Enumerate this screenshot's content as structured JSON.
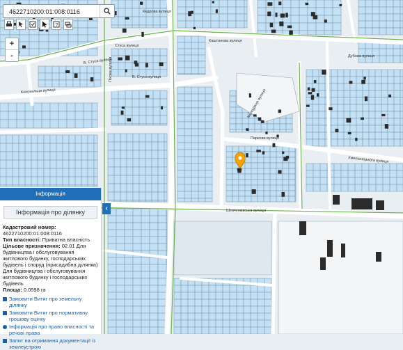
{
  "search": {
    "value": "4622710200:01:008:0116"
  },
  "toolbar": {
    "icons": [
      "print-icon",
      "cursor-icon",
      "edit-icon",
      "pointer-icon",
      "info-icon",
      "layers-icon"
    ]
  },
  "zoom": {
    "plus": "+",
    "minus": "-"
  },
  "streets": {
    "top": "Кедрова вулиця",
    "stus1": "Стуса вулиця",
    "stus2": "В. Стуса вулиця",
    "stus3": "В. Стуса вулиця",
    "konovaltsia": "Коновальця вулиця",
    "pikhova": "Піхова вулиця",
    "right_top": "Каштанова вулиця",
    "dubova": "Дубова вулиця",
    "parkova": "Паркова вулиця",
    "khmelnytskoho": "Хмельницького вулиця",
    "vertical": "Молодіжна вулиця",
    "bottom": "Шевченківська вулиця"
  },
  "panel": {
    "header": "Інформація",
    "title": "Інформація про ділянку",
    "cad_label": "Кадастровий номер:",
    "cad_value": "4622710200:01:008:0116",
    "own_label": "Тип власності:",
    "own_value": "Приватна власність",
    "purpose_label": "Цільове призначення:",
    "purpose_value": "02.01 Для будівництва і обслуговування житлового будинку, господарських будівель і споруд (присадибна ділянка) Для будівництва і обслуговування житлового будинку і господарських будівель",
    "area_label": "Площа:",
    "area_value": "0.0598 га",
    "links": [
      "Замовити Витяг про земельну ділянку",
      "Замовити Витяг про нормативну грошову оцінку",
      "Інформація про право власності та речові права",
      "Запит на отримання документації із землеустрою"
    ]
  },
  "colors": {
    "parcel_fill": "#c4e0f4",
    "parcel_line": "#7f9fb5",
    "road": "#ffffff",
    "green_line": "#6ab04c",
    "building": "#2b2b2b",
    "marker": "#f4a300",
    "panel_header": "#1f6eb8"
  }
}
